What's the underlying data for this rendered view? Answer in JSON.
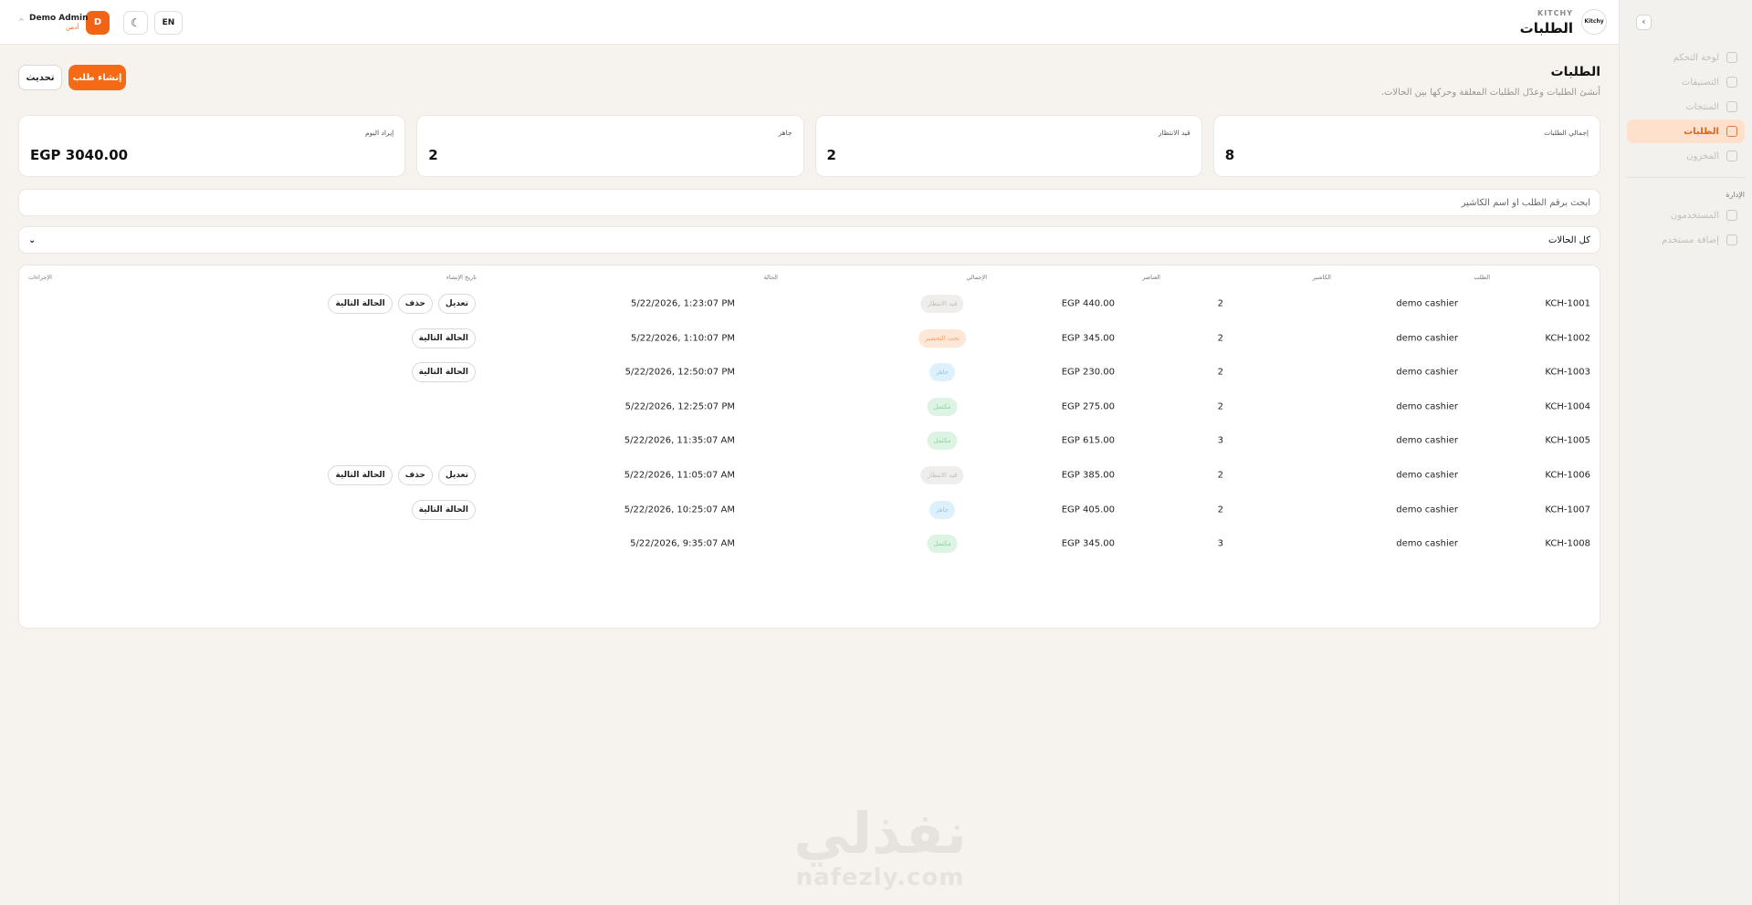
{
  "brand": {
    "name": "KITCHY",
    "logo_text": "Kitchy",
    "page_title": "الطلبات"
  },
  "header": {
    "lang": "EN",
    "theme_icon": "moon-icon",
    "user_initial": "D",
    "user_name": "Demo Admin",
    "user_role": "أدمن"
  },
  "sidebar": {
    "items": [
      {
        "label": "لوحة التحكم",
        "icon": "dashboard-icon"
      },
      {
        "label": "التصنيفات",
        "icon": "list-icon"
      },
      {
        "label": "المنتجات",
        "icon": "cart-icon"
      },
      {
        "label": "الطلبات",
        "icon": "clipboard-icon",
        "active": true
      },
      {
        "label": "المخزون",
        "icon": "box-icon"
      }
    ],
    "admin_section": "الإدارة",
    "admin_items": [
      {
        "label": "المستخدمون",
        "icon": "users-icon"
      },
      {
        "label": "إضافة مستخدم",
        "icon": "user-plus-icon"
      }
    ]
  },
  "page": {
    "title": "الطلبات",
    "subtitle": "أنشئ الطلبات وعدّل الطلبات المعلقة وحركها بين الحالات.",
    "create_label": "إنشاء طلب",
    "refresh_label": "تحديث"
  },
  "stats": [
    {
      "label": "إجمالي الطلبات",
      "value": "8"
    },
    {
      "label": "قيد الانتظار",
      "value": "2"
    },
    {
      "label": "جاهز",
      "value": "2"
    },
    {
      "label": "إيراد اليوم",
      "value": "EGP 3040.00"
    }
  ],
  "search": {
    "placeholder": "ابحث برقم الطلب أو اسم الكاشير"
  },
  "filter": {
    "selected": "كل الحالات"
  },
  "table": {
    "headers": {
      "order": "الطلب",
      "cashier": "الكاشير",
      "items": "العناصر",
      "total": "الإجمالي",
      "status": "الحالة",
      "created": "تاريخ الإنشاء",
      "actions": "الإجراءات"
    },
    "action_labels": {
      "edit": "تعديل",
      "delete": "حذف",
      "next": "الحالة التالية"
    },
    "rows": [
      {
        "id": "KCH-1001",
        "cashier": "demo cashier",
        "items": "2",
        "total": "EGP 440.00",
        "status": "قيد الانتظار",
        "status_type": "wait",
        "created": "5/22/2026, 1:23:07 PM",
        "actions": [
          "next",
          "delete",
          "edit"
        ]
      },
      {
        "id": "KCH-1002",
        "cashier": "demo cashier",
        "items": "2",
        "total": "EGP 345.00",
        "status": "تحت التحضير",
        "status_type": "prep",
        "created": "5/22/2026, 1:10:07 PM",
        "actions": [
          "next"
        ]
      },
      {
        "id": "KCH-1003",
        "cashier": "demo cashier",
        "items": "2",
        "total": "EGP 230.00",
        "status": "جاهز",
        "status_type": "ready",
        "created": "5/22/2026, 12:50:07 PM",
        "actions": [
          "next"
        ]
      },
      {
        "id": "KCH-1004",
        "cashier": "demo cashier",
        "items": "2",
        "total": "EGP 275.00",
        "status": "مكتمل",
        "status_type": "done",
        "created": "5/22/2026, 12:25:07 PM",
        "actions": []
      },
      {
        "id": "KCH-1005",
        "cashier": "demo cashier",
        "items": "3",
        "total": "EGP 615.00",
        "status": "مكتمل",
        "status_type": "done",
        "created": "5/22/2026, 11:35:07 AM",
        "actions": []
      },
      {
        "id": "KCH-1006",
        "cashier": "demo cashier",
        "items": "2",
        "total": "EGP 385.00",
        "status": "قيد الانتظار",
        "status_type": "wait",
        "created": "5/22/2026, 11:05:07 AM",
        "actions": [
          "next",
          "delete",
          "edit"
        ]
      },
      {
        "id": "KCH-1007",
        "cashier": "demo cashier",
        "items": "2",
        "total": "EGP 405.00",
        "status": "جاهز",
        "status_type": "ready",
        "created": "5/22/2026, 10:25:07 AM",
        "actions": [
          "next"
        ]
      },
      {
        "id": "KCH-1008",
        "cashier": "demo cashier",
        "items": "3",
        "total": "EGP 345.00",
        "status": "مكتمل",
        "status_type": "done",
        "created": "5/22/2026, 9:35:07 AM",
        "actions": []
      }
    ]
  },
  "watermark": {
    "arabic": "نفذلي",
    "latin": "nafezly.com"
  }
}
